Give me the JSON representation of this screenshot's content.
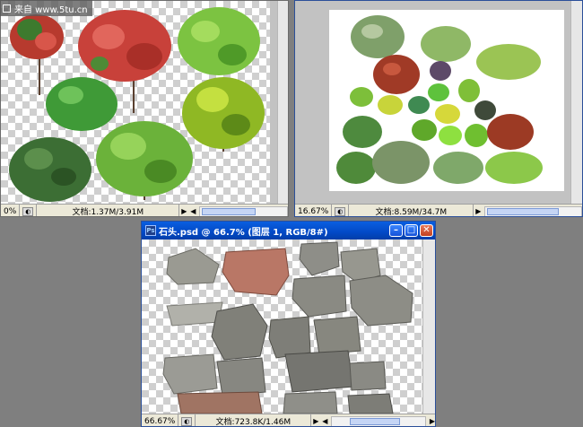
{
  "watermark": {
    "text": "来自 www.5tu.cn"
  },
  "win_trees": {
    "zoom": "0%",
    "doc_label": "文档:1.37M/3.91M"
  },
  "win_shrubs": {
    "zoom": "16.67%",
    "doc_label": "文档:8.59M/34.7M"
  },
  "win_stones": {
    "title": "石头.psd @ 66.7% (图层 1, RGB/8#)",
    "zoom": "66.67%",
    "doc_label": "文档:723.8K/1.46M"
  },
  "icons": {
    "minimize": "minimize-icon",
    "maximize": "maximize-icon",
    "close": "close-icon",
    "scroll_left": "arrow-left-icon",
    "scroll_right": "arrow-right-icon"
  },
  "colors": {
    "titlebar": "#0249c7",
    "workspace": "#7f7f7f",
    "statusbar": "#ece9d8"
  }
}
